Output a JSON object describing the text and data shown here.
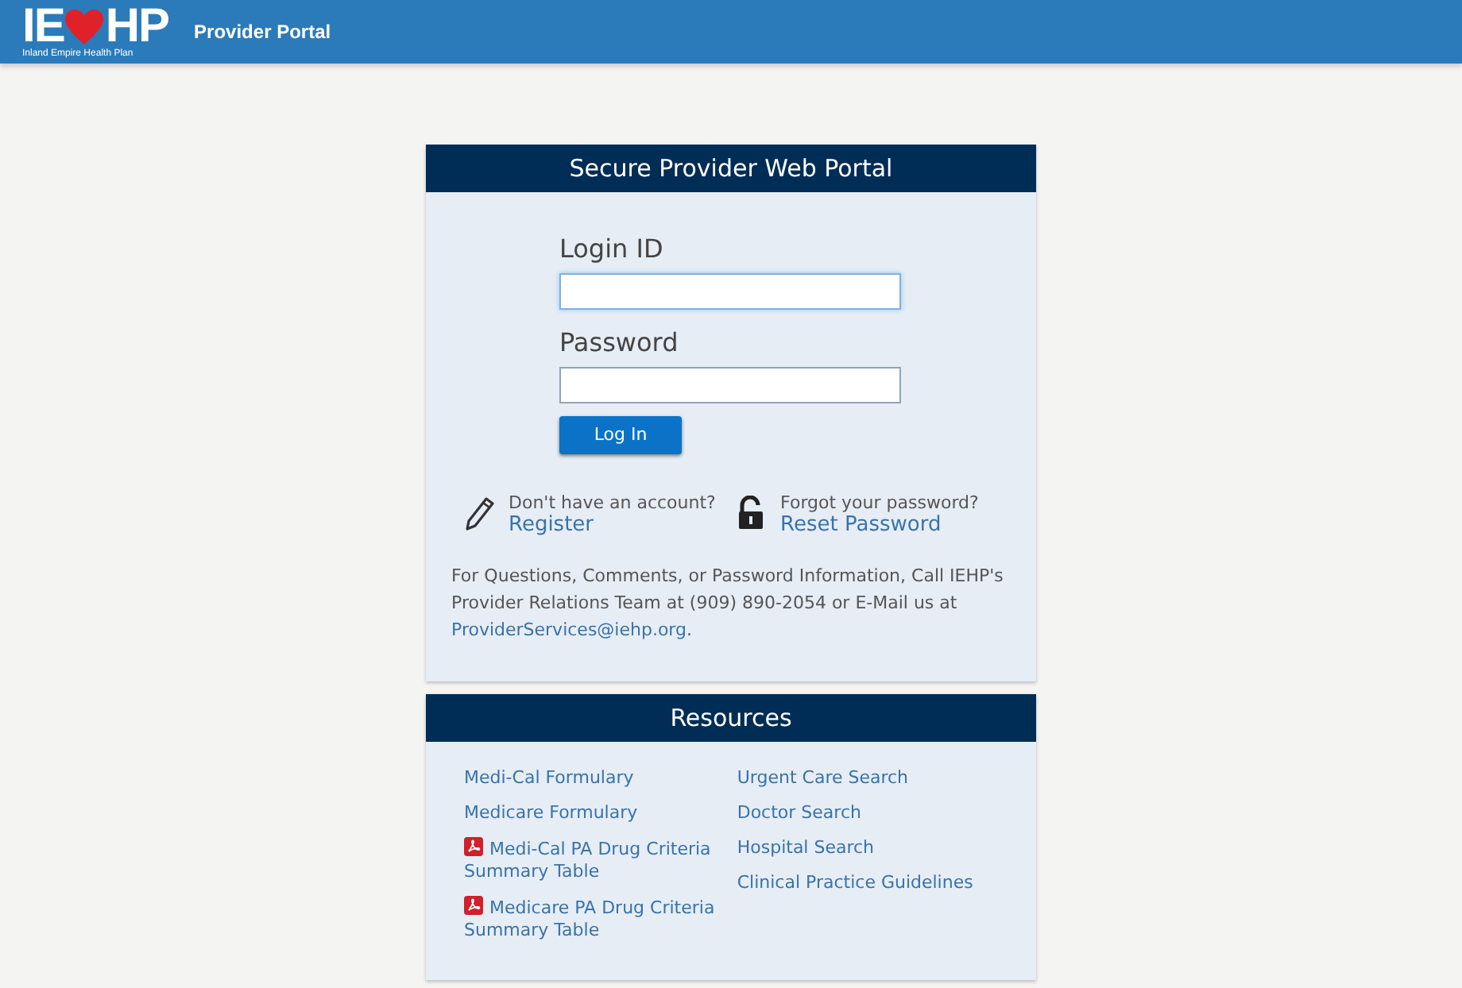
{
  "header": {
    "logo_left": "IE",
    "logo_right": "HP",
    "logo_tagline": "Inland Empire Health Plan",
    "title": "Provider Portal"
  },
  "login": {
    "title": "Secure Provider Web Portal",
    "fields": [
      {
        "label": "Login ID",
        "focused": true
      },
      {
        "label": "Password",
        "focused": false
      }
    ],
    "button": "Log In",
    "register": {
      "prompt": "Don't have an account?",
      "link": "Register"
    },
    "reset": {
      "prompt": "Forgot your password?",
      "link": "Reset Password"
    },
    "contact": {
      "text": "For Questions, Comments, or Password Information, Call IEHP's Provider Relations Team at (909) 890-2054 or E-Mail us at",
      "email": "ProviderServices@iehp.org",
      "end": "."
    }
  },
  "resources": {
    "title": "Resources",
    "columns": [
      [
        {
          "label": "Medi-Cal Formulary",
          "pdf": false
        },
        {
          "label": "Medicare Formulary",
          "pdf": false
        },
        {
          "label": "Medi-Cal PA Drug Criteria Summary Table",
          "pdf": true
        },
        {
          "label": "Medicare PA Drug Criteria Summary Table",
          "pdf": true
        }
      ],
      [
        {
          "label": "Urgent Care Search",
          "pdf": false
        },
        {
          "label": "Doctor Search",
          "pdf": false
        },
        {
          "label": "Hospital Search",
          "pdf": false
        },
        {
          "label": "Clinical Practice Guidelines",
          "pdf": false
        }
      ]
    ]
  }
}
